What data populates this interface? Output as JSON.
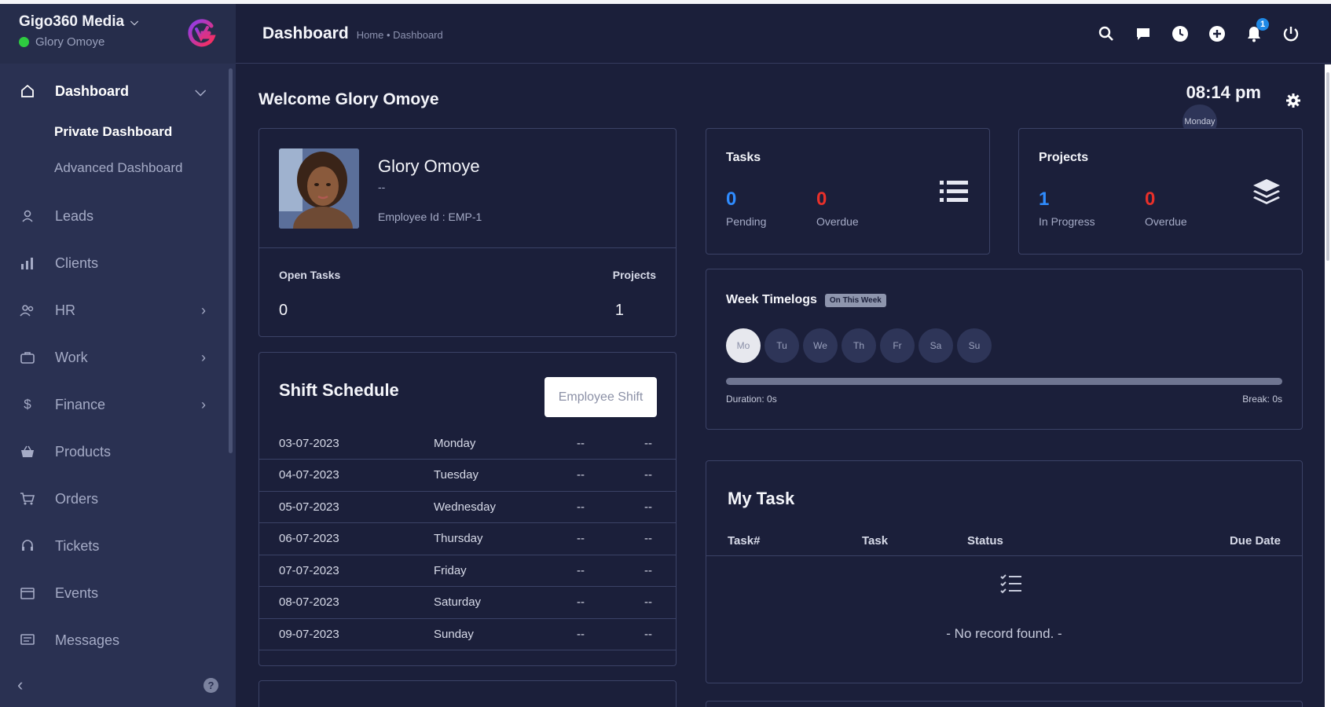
{
  "brand": {
    "company": "Gigo360 Media",
    "user": "Glory Omoye",
    "logo_color": "#e0307a"
  },
  "sidebar": {
    "items": [
      {
        "label": "Dashboard",
        "icon": "home-icon"
      },
      {
        "label": "Leads",
        "icon": "user-icon"
      },
      {
        "label": "Clients",
        "icon": "chart-icon"
      },
      {
        "label": "HR",
        "icon": "people-icon"
      },
      {
        "label": "Work",
        "icon": "briefcase-icon"
      },
      {
        "label": "Finance",
        "icon": "dollar-icon"
      },
      {
        "label": "Products",
        "icon": "basket-icon"
      },
      {
        "label": "Orders",
        "icon": "cart-icon"
      },
      {
        "label": "Tickets",
        "icon": "headset-icon"
      },
      {
        "label": "Events",
        "icon": "calendar-icon"
      },
      {
        "label": "Messages",
        "icon": "message-icon"
      }
    ],
    "sub_items": [
      "Private Dashboard",
      "Advanced Dashboard"
    ]
  },
  "header": {
    "title": "Dashboard",
    "breadcrumb": "Home • Dashboard",
    "notification_count": "1"
  },
  "main": {
    "welcome": "Welcome Glory Omoye",
    "clock_time": "08:14 pm",
    "clock_day": "Monday"
  },
  "profile": {
    "name": "Glory Omoye",
    "designation": "--",
    "employee_id": "Employee Id : EMP-1",
    "open_tasks_label": "Open Tasks",
    "open_tasks_value": "0",
    "projects_label": "Projects",
    "projects_value": "1"
  },
  "tasks": {
    "title": "Tasks",
    "pending_value": "0",
    "pending_label": "Pending",
    "overdue_value": "0",
    "overdue_label": "Overdue"
  },
  "projects": {
    "title": "Projects",
    "in_progress_value": "1",
    "in_progress_label": "In Progress",
    "overdue_value": "0",
    "overdue_label": "Overdue"
  },
  "timelogs": {
    "title": "Week Timelogs",
    "badge": "On This Week",
    "days": [
      "Mo",
      "Tu",
      "We",
      "Th",
      "Fr",
      "Sa",
      "Su"
    ],
    "duration": "Duration: 0s",
    "break": "Break: 0s"
  },
  "shift": {
    "title": "Shift Schedule",
    "button": "Employee Shift",
    "rows": [
      [
        "03-07-2023",
        "Monday",
        "--",
        "--"
      ],
      [
        "04-07-2023",
        "Tuesday",
        "--",
        "--"
      ],
      [
        "05-07-2023",
        "Wednesday",
        "--",
        "--"
      ],
      [
        "06-07-2023",
        "Thursday",
        "--",
        "--"
      ],
      [
        "07-07-2023",
        "Friday",
        "--",
        "--"
      ],
      [
        "08-07-2023",
        "Saturday",
        "--",
        "--"
      ],
      [
        "09-07-2023",
        "Sunday",
        "--",
        "--"
      ]
    ]
  },
  "mytask": {
    "title": "My Task",
    "columns": [
      "Task#",
      "Task",
      "Status",
      "Due Date"
    ],
    "empty": "- No record found. -"
  }
}
